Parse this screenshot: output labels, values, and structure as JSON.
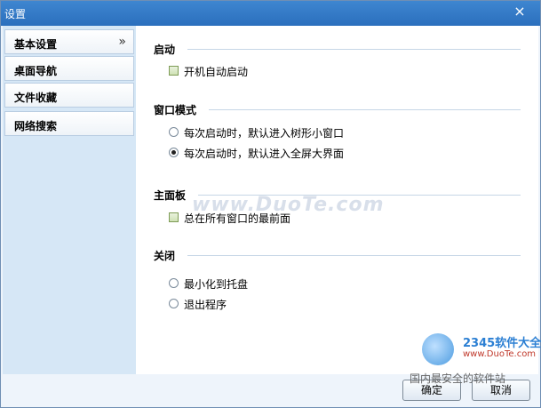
{
  "window": {
    "title": "设置",
    "close_symbol": "×"
  },
  "sidebar": {
    "items": [
      {
        "label": "基本设置",
        "chevron": "»"
      },
      {
        "label": "桌面导航"
      },
      {
        "label": "文件收藏"
      },
      {
        "label": "网络搜索"
      }
    ]
  },
  "sections": {
    "startup": {
      "title": "启动",
      "option": "开机自动启动",
      "checked": false
    },
    "window_mode": {
      "title": "窗口模式",
      "options": [
        "每次启动时，默认进入树形小窗口",
        "每次启动时，默认进入全屏大界面"
      ],
      "selected_index": 1
    },
    "main_panel": {
      "title": "主面板",
      "option": "总在所有窗口的最前面",
      "checked": false
    },
    "close": {
      "title": "关闭",
      "options": [
        "最小化到托盘",
        "退出程序"
      ],
      "selected_index": -1
    }
  },
  "footer": {
    "ok_label": "确定",
    "cancel_label": "取消"
  },
  "overlays": {
    "watermark": "www.DuoTe.com",
    "badge_logo": "2345软件大全",
    "badge_url": "www.DuoTe.com",
    "badge_slogan": "国内最安全的软件站"
  }
}
